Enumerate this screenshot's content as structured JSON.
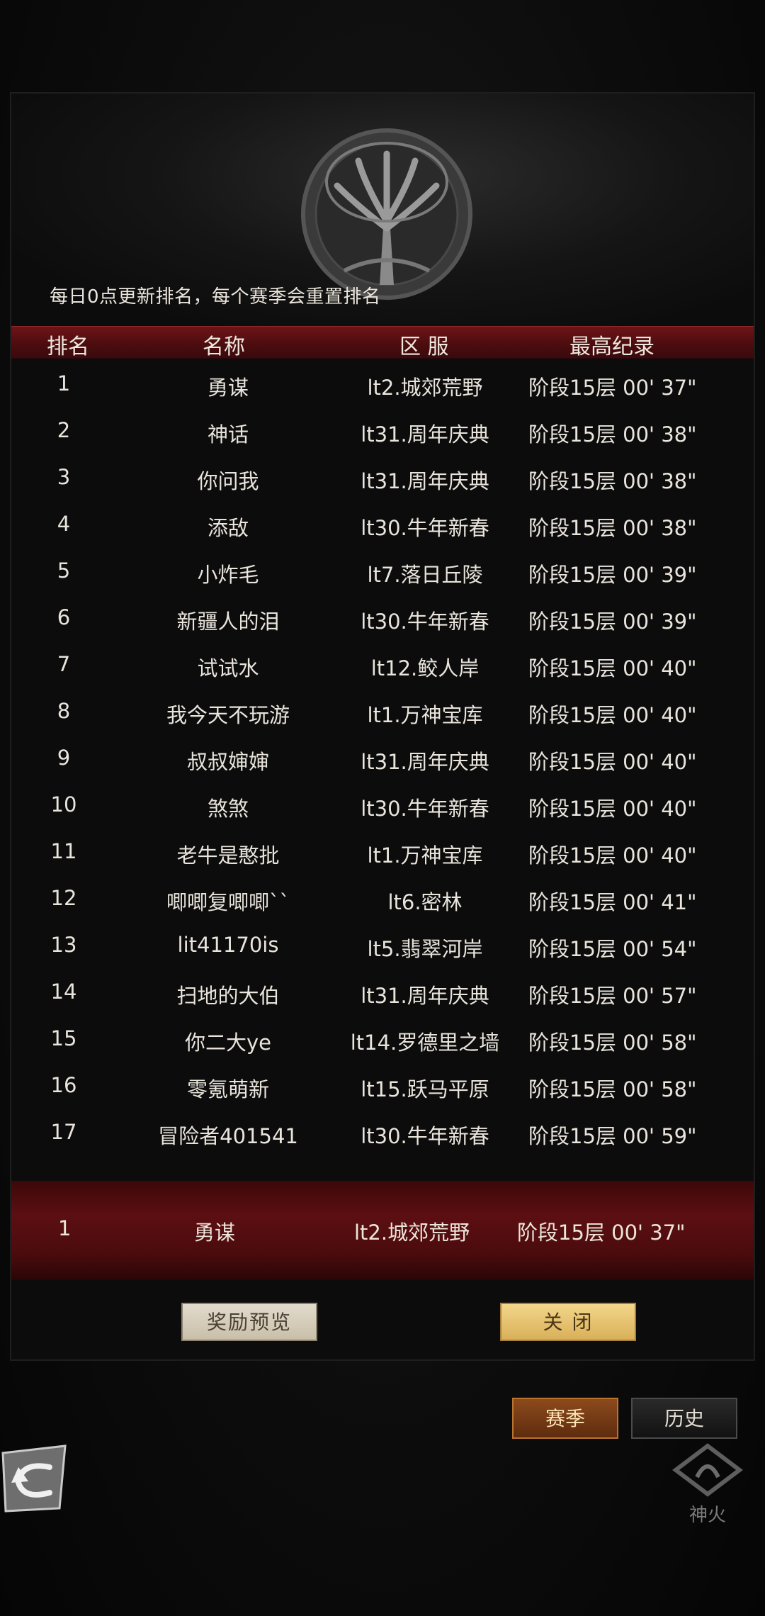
{
  "notice": "每日0点更新排名，每个赛季会重置排名",
  "header": {
    "rank": "排名",
    "name": "名称",
    "server": "区 服",
    "record": "最高纪录"
  },
  "rows": [
    {
      "rank": "1",
      "name": "勇谋",
      "server": "lt2.城郊荒野",
      "record": "阶段15层  00' 37\""
    },
    {
      "rank": "2",
      "name": "神话",
      "server": "lt31.周年庆典",
      "record": "阶段15层  00' 38\""
    },
    {
      "rank": "3",
      "name": "你问我",
      "server": "lt31.周年庆典",
      "record": "阶段15层  00' 38\""
    },
    {
      "rank": "4",
      "name": "添敌",
      "server": "lt30.牛年新春",
      "record": "阶段15层  00' 38\""
    },
    {
      "rank": "5",
      "name": "小炸毛",
      "server": "lt7.落日丘陵",
      "record": "阶段15层  00' 39\""
    },
    {
      "rank": "6",
      "name": "新疆人的泪",
      "server": "lt30.牛年新春",
      "record": "阶段15层  00' 39\""
    },
    {
      "rank": "7",
      "name": "试试水",
      "server": "lt12.鲛人岸",
      "record": "阶段15层  00' 40\""
    },
    {
      "rank": "8",
      "name": "我今天不玩游",
      "server": "lt1.万神宝库",
      "record": "阶段15层  00' 40\""
    },
    {
      "rank": "9",
      "name": "叔叔婶婶",
      "server": "lt31.周年庆典",
      "record": "阶段15层  00' 40\""
    },
    {
      "rank": "10",
      "name": "煞煞",
      "server": "lt30.牛年新春",
      "record": "阶段15层  00' 40\""
    },
    {
      "rank": "11",
      "name": "老牛是憨批",
      "server": "lt1.万神宝库",
      "record": "阶段15层  00' 40\""
    },
    {
      "rank": "12",
      "name": "唧唧复唧唧``",
      "server": "lt6.密林",
      "record": "阶段15层  00' 41\""
    },
    {
      "rank": "13",
      "name": "lit41170is",
      "server": "lt5.翡翠河岸",
      "record": "阶段15层  00' 54\""
    },
    {
      "rank": "14",
      "name": "扫地的大伯",
      "server": "lt31.周年庆典",
      "record": "阶段15层  00' 57\""
    },
    {
      "rank": "15",
      "name": "你二大ye",
      "server": "lt14.罗德里之墙",
      "record": "阶段15层  00' 58\""
    },
    {
      "rank": "16",
      "name": "零氪萌新",
      "server": "lt15.跃马平原",
      "record": "阶段15层  00' 58\""
    },
    {
      "rank": "17",
      "name": "冒险者401541",
      "server": "lt30.牛年新春",
      "record": "阶段15层  00' 59\""
    }
  ],
  "my_row": {
    "rank": "1",
    "name": "勇谋",
    "server": "lt2.城郊荒野",
    "record": "阶段15层  00' 37\""
  },
  "buttons": {
    "preview": "奖励预览",
    "close": "关 闭"
  },
  "tabs": {
    "season": "赛季",
    "history": "历史"
  },
  "logo": {
    "text": "神火"
  },
  "icons": {
    "back": "back-arrow-icon",
    "emblem": "tree-emblem-icon"
  }
}
